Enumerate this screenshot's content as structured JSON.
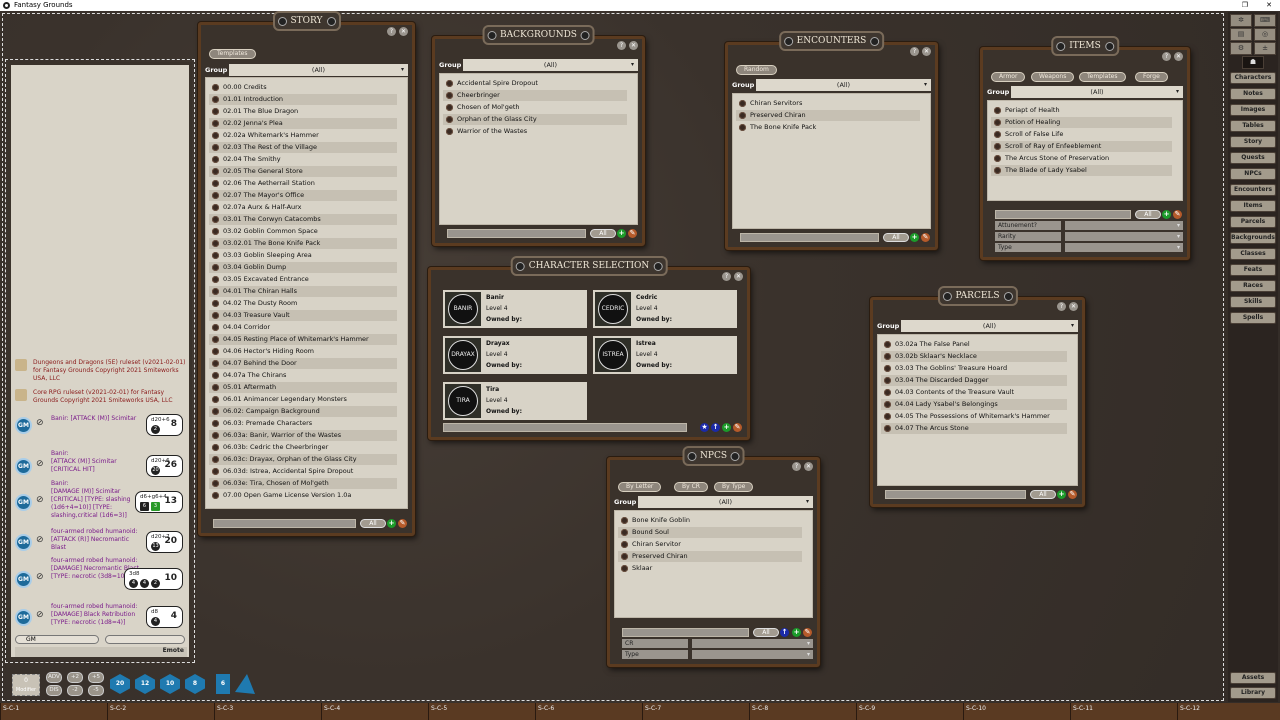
{
  "app": {
    "title": "Fantasy Grounds"
  },
  "windows": {
    "story": {
      "title": "STORY",
      "tabs": [
        "Templates"
      ],
      "group_label": "Group",
      "group_value": "(All)",
      "filter_all": "All",
      "items": [
        "00.00 Credits",
        "01.01 Introduction",
        "02.01 The Blue Dragon",
        "02.02 Jenna's Plea",
        "02.02a Whitemark's Hammer",
        "02.03 The Rest of the Village",
        "02.04 The Smithy",
        "02.05 The General Store",
        "02.06 The Aetherrail Station",
        "02.07 The Mayor's Office",
        "02.07a Aurx & Half-Aurx",
        "03.01 The Corwyn Catacombs",
        "03.02 Goblin Common Space",
        "03.02.01 The Bone Knife Pack",
        "03.03 Goblin Sleeping Area",
        "03.04 Goblin Dump",
        "03.05 Excavated Entrance",
        "04.01 The Chiran Halls",
        "04.02 The Dusty Room",
        "04.03 Treasure Vault",
        "04.04 Corridor",
        "04.05 Resting Place of Whitemark's Hammer",
        "04.06 Hector's Hiding Room",
        "04.07 Behind the Door",
        "04.07a The Chirans",
        "05.01 Aftermath",
        "06.01 Animancer Legendary Monsters",
        "06.02: Campaign Background",
        "06.03: Premade Characters",
        "06.03a: Banir, Warrior of the Wastes",
        "06.03b: Cedric the Cheerbringer",
        "06.03c: Drayax, Orphan of the Glass City",
        "06.03d: Istrea, Accidental Spire Dropout",
        "06.03e: Tira, Chosen of Mol'geth",
        "07.00 Open Game License Version 1.0a"
      ]
    },
    "backgrounds": {
      "title": "BACKGROUNDS",
      "tabs": [],
      "group_label": "Group",
      "group_value": "(All)",
      "filter_all": "All",
      "items": [
        "Accidental Spire Dropout",
        "Cheerbringer",
        "Chosen of Mol'geth",
        "Orphan of the Glass City",
        "Warrior of the Wastes"
      ]
    },
    "encounters": {
      "title": "ENCOUNTERS",
      "tabs": [
        "Random"
      ],
      "group_label": "Group",
      "group_value": "(All)",
      "filter_all": "All",
      "items": [
        "Chiran Servitors",
        "Preserved Chiran",
        "The Bone Knife Pack"
      ]
    },
    "items": {
      "title": "ITEMS",
      "tabs": [
        "Armor",
        "Weapons",
        "Templates",
        "Forge"
      ],
      "group_label": "Group",
      "group_value": "(All)",
      "filter_all": "All",
      "items": [
        "Periapt of Health",
        "Potion of Healing",
        "Scroll of False Life",
        "Scroll of Ray of Enfeeblement",
        "The Arcus Stone of Preservation",
        "The Blade of Lady Ysabel"
      ],
      "filters": [
        "Attunement?",
        "Rarity",
        "Type"
      ]
    },
    "parcels": {
      "title": "PARCELS",
      "tabs": [],
      "group_label": "Group",
      "group_value": "(All)",
      "filter_all": "All",
      "items": [
        "03.02a The False Panel",
        "03.02b Sklaar's Necklace",
        "03.03 The Goblins' Treasure Hoard",
        "03.04 The Discarded Dagger",
        "04.03 Contents of the Treasure Vault",
        "04.04 Lady Ysabel's Belongings",
        "04.05 The Possessions of Whitemark's Hammer",
        "04.07 The Arcus Stone"
      ]
    },
    "npcs": {
      "title": "NPCS",
      "tabs": [
        "By Letter",
        "By CR",
        "By Type"
      ],
      "group_label": "Group",
      "group_value": "(All)",
      "filter_all": "All",
      "items": [
        "Bone Knife Goblin",
        "Bound Soul",
        "Chiran Servitor",
        "Preserved Chiran",
        "Sklaar"
      ],
      "filters": [
        "CR",
        "Type"
      ]
    }
  },
  "character_selection": {
    "title": "CHARACTER SELECTION",
    "owned_label": "Owned by:",
    "characters": [
      {
        "portrait": "BANIR",
        "name": "Banir",
        "level": "Level 4"
      },
      {
        "portrait": "CEDRIC",
        "name": "Cedric",
        "level": "Level 4"
      },
      {
        "portrait": "DRAYAX",
        "name": "Drayax",
        "level": "Level 4"
      },
      {
        "portrait": "ISTREA",
        "name": "Istrea",
        "level": "Level 4"
      },
      {
        "portrait": "TIRA",
        "name": "Tira",
        "level": "Level 4"
      }
    ]
  },
  "chat": {
    "system": [
      "Dungeons and Dragons (5E) ruleset (v2021-02-01) for Fantasy Grounds Copyright 2021 Smiteworks USA, LLC",
      "Core RPG ruleset (v2021-02-01) for Fantasy Grounds Copyright 2021 Smiteworks USA, LLC"
    ],
    "messages": [
      {
        "avatar": "GM",
        "text": "Banir:   [ATTACK (M)] Scimitar",
        "expr": "d20+6",
        "dice": [
          "2"
        ],
        "total": "8"
      },
      {
        "avatar": "GM",
        "text": "Banir:\n[ATTACK (M)] Scimitar [CRITICAL HIT]",
        "expr": "d20+6",
        "dice": [
          "20"
        ],
        "total": "26"
      },
      {
        "avatar": "GM",
        "text": "Banir:\n[DAMAGE (M)] Scimitar [CRITICAL] [TYPE: slashing (1d6+4=10)] [TYPE: slashing,critical (1d6=3)]",
        "expr": "d6+g6+4",
        "dice": [
          "6",
          "3"
        ],
        "total": "13"
      },
      {
        "avatar": "GM",
        "text": "four-armed robed humanoid:\n[ATTACK (R)] Necromantic Blast",
        "expr": "d20+7",
        "dice": [
          "13"
        ],
        "total": "20"
      },
      {
        "avatar": "GM",
        "text": "four-armed robed humanoid:\n[DAMAGE] Necromantic Blast [TYPE: necrotic (3d8=10)]",
        "expr": "3d8",
        "dice": [
          "4",
          "4",
          "2"
        ],
        "total": "10"
      },
      {
        "avatar": "GM",
        "text": "four-armed robed humanoid:\n[DAMAGE] Black Retribution [TYPE: necrotic (1d8=4)]",
        "expr": "d8",
        "dice": [
          "4"
        ],
        "total": "4"
      }
    ],
    "speaker": "GM",
    "mode": "",
    "emote_label": "Emote"
  },
  "modifier": {
    "value": "0",
    "label": "Modifier",
    "buttons": [
      "ADV",
      "+2",
      "+5",
      "DIS",
      "-2",
      "-5"
    ]
  },
  "dice_tray": [
    "20",
    "12",
    "10",
    "8",
    "6",
    ""
  ],
  "sidebar": {
    "tools": [
      "dice-tower",
      "dice-calc",
      "map",
      "effects",
      "options",
      "+/-"
    ],
    "items": [
      "Characters",
      "Notes",
      "Images",
      "Tables",
      "Story",
      "Quests",
      "NPCs",
      "Encounters",
      "Items",
      "Parcels",
      "Backgrounds",
      "Classes",
      "Feats",
      "Races",
      "Skills",
      "Spells"
    ],
    "bottom": [
      "Assets",
      "Library"
    ]
  },
  "scene_tabs": [
    "S-C-1",
    "S-C-2",
    "S-C-3",
    "S-C-4",
    "S-C-5",
    "S-C-6",
    "S-C-7",
    "S-C-8",
    "S-C-9",
    "S-C-10",
    "S-C-11",
    "S-C-12"
  ]
}
